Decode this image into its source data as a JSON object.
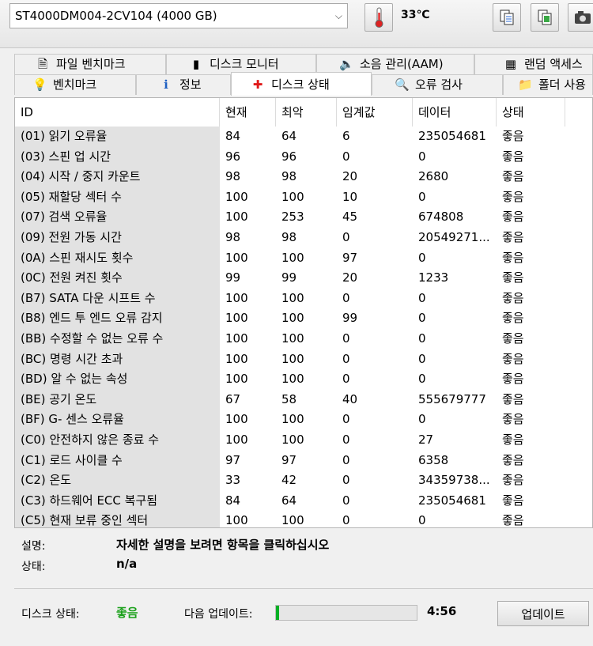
{
  "drive": {
    "selected": "ST4000DM004-2CV104 (4000 GB)"
  },
  "temperature": "33℃",
  "toolbar": {
    "icons": [
      "thermometer-icon",
      "copy-icon",
      "copy-image-icon",
      "camera-icon"
    ]
  },
  "tabs_row1": [
    {
      "label": "파일 벤치마크",
      "icon": "file-benchmark-icon"
    },
    {
      "label": "디스크 모니터",
      "icon": "chart-icon"
    },
    {
      "label": "소음 관리(AAM)",
      "icon": "speaker-icon"
    },
    {
      "label": "랜덤 액세스",
      "icon": "random-access-icon"
    }
  ],
  "tabs_row2": [
    {
      "label": "벤치마크",
      "icon": "bulb-icon"
    },
    {
      "label": "정보",
      "icon": "info-icon"
    },
    {
      "label": "디스크 상태",
      "icon": "health-cross-icon",
      "active": true
    },
    {
      "label": "오류 검사",
      "icon": "magnifier-icon"
    },
    {
      "label": "폴더 사용",
      "icon": "folder-icon"
    }
  ],
  "table": {
    "columns": [
      "ID",
      "현재",
      "최악",
      "임계값",
      "데이터",
      "상태"
    ],
    "rows": [
      [
        "(01) 읽기 오류율",
        "84",
        "64",
        "6",
        "235054681",
        "좋음"
      ],
      [
        "(03) 스핀 업 시간",
        "96",
        "96",
        "0",
        "0",
        "좋음"
      ],
      [
        "(04) 시작 / 중지 카운트",
        "98",
        "98",
        "20",
        "2680",
        "좋음"
      ],
      [
        "(05) 재할당 섹터 수",
        "100",
        "100",
        "10",
        "0",
        "좋음"
      ],
      [
        "(07) 검색 오류율",
        "100",
        "253",
        "45",
        "674808",
        "좋음"
      ],
      [
        "(09) 전원 가동 시간",
        "98",
        "98",
        "0",
        "20549271...",
        "좋음"
      ],
      [
        "(0A) 스핀 재시도 횟수",
        "100",
        "100",
        "97",
        "0",
        "좋음"
      ],
      [
        "(0C) 전원 켜진 횟수",
        "99",
        "99",
        "20",
        "1233",
        "좋음"
      ],
      [
        "(B7) SATA 다운 시프트 수",
        "100",
        "100",
        "0",
        "0",
        "좋음"
      ],
      [
        "(B8) 엔드 투 엔드 오류 감지",
        "100",
        "100",
        "99",
        "0",
        "좋음"
      ],
      [
        "(BB) 수정할 수 없는 오류 수",
        "100",
        "100",
        "0",
        "0",
        "좋음"
      ],
      [
        "(BC) 명령 시간 초과",
        "100",
        "100",
        "0",
        "0",
        "좋음"
      ],
      [
        "(BD) 알 수 없는 속성",
        "100",
        "100",
        "0",
        "0",
        "좋음"
      ],
      [
        "(BE) 공기 온도",
        "67",
        "58",
        "40",
        "555679777",
        "좋음"
      ],
      [
        "(BF) G- 센스 오류율",
        "100",
        "100",
        "0",
        "0",
        "좋음"
      ],
      [
        "(C0) 안전하지 않은 종료 수",
        "100",
        "100",
        "0",
        "27",
        "좋음"
      ],
      [
        "(C1) 로드 사이클 수",
        "97",
        "97",
        "0",
        "6358",
        "좋음"
      ],
      [
        "(C2) 온도",
        "33",
        "42",
        "0",
        "34359738...",
        "좋음"
      ],
      [
        "(C3) 하드웨어 ECC 복구됨",
        "84",
        "64",
        "0",
        "235054681",
        "좋음"
      ],
      [
        "(C5) 현재 보류 중인 섹터",
        "100",
        "100",
        "0",
        "0",
        "좋음"
      ]
    ]
  },
  "info": {
    "description_label": "설명:",
    "description_value": "자세한 설명을 보려면 항목을 클릭하십시오",
    "status_label": "상태:",
    "status_value": "n/a"
  },
  "footer": {
    "disk_status_label": "디스크 상태:",
    "disk_status_value": "좋음",
    "disk_status_color": "#1aa01a",
    "next_update_label": "다음 업데이트:",
    "progress_fraction": 0.02,
    "countdown": "4:56",
    "update_button": "업데이트"
  }
}
